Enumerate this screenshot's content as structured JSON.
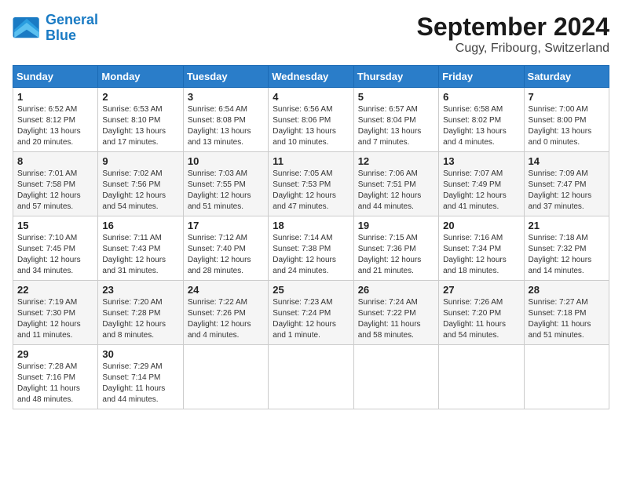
{
  "header": {
    "logo_line1": "General",
    "logo_line2": "Blue",
    "month": "September 2024",
    "location": "Cugy, Fribourg, Switzerland"
  },
  "days_of_week": [
    "Sunday",
    "Monday",
    "Tuesday",
    "Wednesday",
    "Thursday",
    "Friday",
    "Saturday"
  ],
  "weeks": [
    [
      {
        "day": "1",
        "info": "Sunrise: 6:52 AM\nSunset: 8:12 PM\nDaylight: 13 hours and 20 minutes."
      },
      {
        "day": "2",
        "info": "Sunrise: 6:53 AM\nSunset: 8:10 PM\nDaylight: 13 hours and 17 minutes."
      },
      {
        "day": "3",
        "info": "Sunrise: 6:54 AM\nSunset: 8:08 PM\nDaylight: 13 hours and 13 minutes."
      },
      {
        "day": "4",
        "info": "Sunrise: 6:56 AM\nSunset: 8:06 PM\nDaylight: 13 hours and 10 minutes."
      },
      {
        "day": "5",
        "info": "Sunrise: 6:57 AM\nSunset: 8:04 PM\nDaylight: 13 hours and 7 minutes."
      },
      {
        "day": "6",
        "info": "Sunrise: 6:58 AM\nSunset: 8:02 PM\nDaylight: 13 hours and 4 minutes."
      },
      {
        "day": "7",
        "info": "Sunrise: 7:00 AM\nSunset: 8:00 PM\nDaylight: 13 hours and 0 minutes."
      }
    ],
    [
      {
        "day": "8",
        "info": "Sunrise: 7:01 AM\nSunset: 7:58 PM\nDaylight: 12 hours and 57 minutes."
      },
      {
        "day": "9",
        "info": "Sunrise: 7:02 AM\nSunset: 7:56 PM\nDaylight: 12 hours and 54 minutes."
      },
      {
        "day": "10",
        "info": "Sunrise: 7:03 AM\nSunset: 7:55 PM\nDaylight: 12 hours and 51 minutes."
      },
      {
        "day": "11",
        "info": "Sunrise: 7:05 AM\nSunset: 7:53 PM\nDaylight: 12 hours and 47 minutes."
      },
      {
        "day": "12",
        "info": "Sunrise: 7:06 AM\nSunset: 7:51 PM\nDaylight: 12 hours and 44 minutes."
      },
      {
        "day": "13",
        "info": "Sunrise: 7:07 AM\nSunset: 7:49 PM\nDaylight: 12 hours and 41 minutes."
      },
      {
        "day": "14",
        "info": "Sunrise: 7:09 AM\nSunset: 7:47 PM\nDaylight: 12 hours and 37 minutes."
      }
    ],
    [
      {
        "day": "15",
        "info": "Sunrise: 7:10 AM\nSunset: 7:45 PM\nDaylight: 12 hours and 34 minutes."
      },
      {
        "day": "16",
        "info": "Sunrise: 7:11 AM\nSunset: 7:43 PM\nDaylight: 12 hours and 31 minutes."
      },
      {
        "day": "17",
        "info": "Sunrise: 7:12 AM\nSunset: 7:40 PM\nDaylight: 12 hours and 28 minutes."
      },
      {
        "day": "18",
        "info": "Sunrise: 7:14 AM\nSunset: 7:38 PM\nDaylight: 12 hours and 24 minutes."
      },
      {
        "day": "19",
        "info": "Sunrise: 7:15 AM\nSunset: 7:36 PM\nDaylight: 12 hours and 21 minutes."
      },
      {
        "day": "20",
        "info": "Sunrise: 7:16 AM\nSunset: 7:34 PM\nDaylight: 12 hours and 18 minutes."
      },
      {
        "day": "21",
        "info": "Sunrise: 7:18 AM\nSunset: 7:32 PM\nDaylight: 12 hours and 14 minutes."
      }
    ],
    [
      {
        "day": "22",
        "info": "Sunrise: 7:19 AM\nSunset: 7:30 PM\nDaylight: 12 hours and 11 minutes."
      },
      {
        "day": "23",
        "info": "Sunrise: 7:20 AM\nSunset: 7:28 PM\nDaylight: 12 hours and 8 minutes."
      },
      {
        "day": "24",
        "info": "Sunrise: 7:22 AM\nSunset: 7:26 PM\nDaylight: 12 hours and 4 minutes."
      },
      {
        "day": "25",
        "info": "Sunrise: 7:23 AM\nSunset: 7:24 PM\nDaylight: 12 hours and 1 minute."
      },
      {
        "day": "26",
        "info": "Sunrise: 7:24 AM\nSunset: 7:22 PM\nDaylight: 11 hours and 58 minutes."
      },
      {
        "day": "27",
        "info": "Sunrise: 7:26 AM\nSunset: 7:20 PM\nDaylight: 11 hours and 54 minutes."
      },
      {
        "day": "28",
        "info": "Sunrise: 7:27 AM\nSunset: 7:18 PM\nDaylight: 11 hours and 51 minutes."
      }
    ],
    [
      {
        "day": "29",
        "info": "Sunrise: 7:28 AM\nSunset: 7:16 PM\nDaylight: 11 hours and 48 minutes."
      },
      {
        "day": "30",
        "info": "Sunrise: 7:29 AM\nSunset: 7:14 PM\nDaylight: 11 hours and 44 minutes."
      },
      {
        "day": "",
        "info": ""
      },
      {
        "day": "",
        "info": ""
      },
      {
        "day": "",
        "info": ""
      },
      {
        "day": "",
        "info": ""
      },
      {
        "day": "",
        "info": ""
      }
    ]
  ]
}
